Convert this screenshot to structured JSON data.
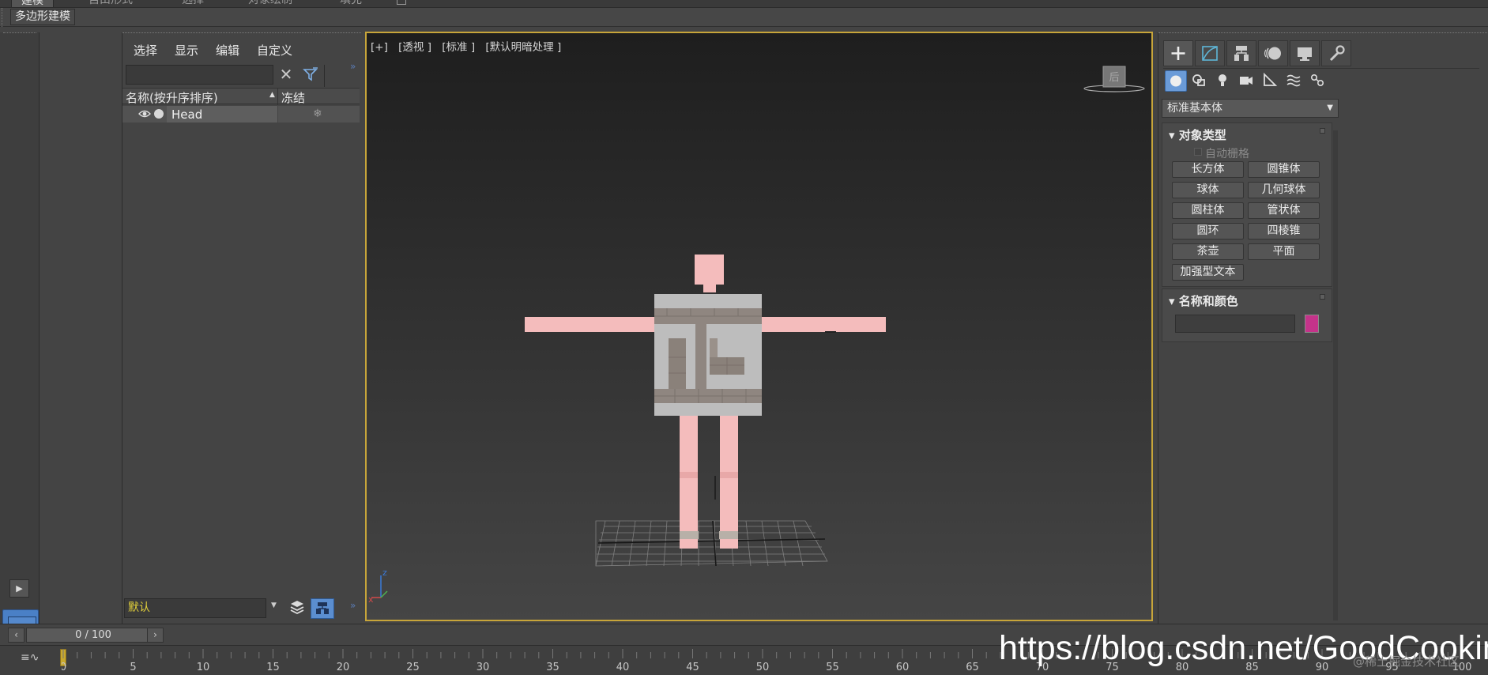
{
  "ribbon": {
    "tabs": [
      "建模",
      "自由形式",
      "选择",
      "对象绘制",
      "填充"
    ],
    "active_label": "多边形建模"
  },
  "scene_explorer": {
    "menu": [
      "选择",
      "显示",
      "编辑",
      "自定义"
    ],
    "search_value": "",
    "column_name": "名称(按升序排序)",
    "column_frozen": "冻结",
    "rows": [
      {
        "name": "Head"
      }
    ],
    "layer": "默认"
  },
  "viewport": {
    "label_parts": [
      "[+]",
      "[透视 ]",
      "[标准 ]",
      "[默认明暗处理 ]"
    ],
    "viewcube_face": "后",
    "axis_z": "z",
    "axis_x": "x",
    "colors": {
      "border": "#c7a53a",
      "skin": "#f4bcbc",
      "torso": "#bdbdbd"
    }
  },
  "command_panel": {
    "tabs": [
      "create-icon",
      "modify-icon",
      "hierarchy-icon",
      "motion-icon",
      "display-icon",
      "utilities-icon"
    ],
    "category": "标准基本体",
    "object_type_title": "对象类型",
    "autogrid": "自动栅格",
    "primitives": [
      "长方体",
      "圆锥体",
      "球体",
      "几何球体",
      "圆柱体",
      "管状体",
      "圆环",
      "四棱锥",
      "茶壶",
      "平面",
      "加强型文本"
    ],
    "name_color_title": "名称和颜色",
    "name_value": "",
    "object_color": "#c4338a"
  },
  "timeline": {
    "frame_display": "0 / 100",
    "ticks": [
      0,
      5,
      10,
      15,
      20,
      25,
      30,
      35,
      40,
      45,
      50,
      55,
      60,
      65,
      70,
      75,
      80,
      85,
      90,
      95,
      100
    ]
  },
  "watermark": "https://blog.csdn.net/GoodCooking",
  "watermark_small": "@稀土掘金技术社区"
}
